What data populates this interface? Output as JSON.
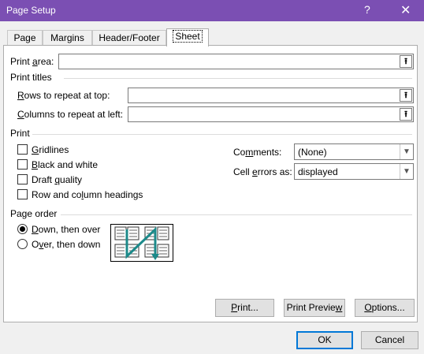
{
  "window": {
    "title": "Page Setup",
    "help_glyph": "?",
    "close_glyph": "✕"
  },
  "tabs": [
    {
      "label": "Page",
      "active": false
    },
    {
      "label": "Margins",
      "active": false
    },
    {
      "label": "Header/Footer",
      "active": false
    },
    {
      "label": "Sheet",
      "active": true
    }
  ],
  "sheet": {
    "print_area": {
      "label_pre": "Print ",
      "label_u": "a",
      "label_post": "rea:",
      "value": ""
    },
    "print_titles": {
      "heading": "Print titles",
      "rows": {
        "label_u": "R",
        "label_post": "ows to repeat at top:",
        "value": ""
      },
      "columns": {
        "label_u": "C",
        "label_post": "olumns to repeat at left:",
        "value": ""
      }
    },
    "print": {
      "heading": "Print",
      "gridlines": {
        "label_u": "G",
        "label_post": "ridlines",
        "checked": false
      },
      "black_white": {
        "label_u": "B",
        "label_post": "lack and white",
        "checked": false
      },
      "draft": {
        "label_pre": "Draft ",
        "label_u": "q",
        "label_post": "uality",
        "checked": false
      },
      "headings": {
        "label_pre": "Row and co",
        "label_u": "l",
        "label_post": "umn headings",
        "checked": false
      },
      "comments": {
        "label_pre": "Co",
        "label_u": "m",
        "label_post": "ments:",
        "value": "(None)"
      },
      "cell_errors": {
        "label_pre": "Cell ",
        "label_u": "e",
        "label_post": "rrors as:",
        "value": "displayed"
      }
    },
    "page_order": {
      "heading": "Page order",
      "down_over": {
        "label_u": "D",
        "label_post": "own, then over",
        "selected": true
      },
      "over_down": {
        "label_pre": "O",
        "label_u": "v",
        "label_post": "er, then down",
        "selected": false
      }
    }
  },
  "buttons": {
    "print": {
      "label_u": "P",
      "label_post": "rint..."
    },
    "preview": {
      "label_pre": "Print Previe",
      "label_u": "w",
      "label_post": ""
    },
    "options": {
      "label_u": "O",
      "label_post": "ptions..."
    },
    "ok": "OK",
    "cancel": "Cancel"
  },
  "colors": {
    "titlebar": "#7b4fb3",
    "accent": "#0078d7"
  }
}
